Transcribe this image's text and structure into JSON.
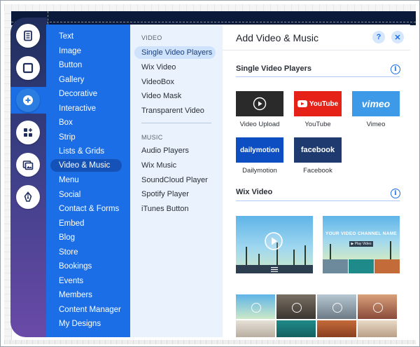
{
  "rail": {
    "buttons": [
      {
        "icon": "pages-icon"
      },
      {
        "icon": "background-icon"
      },
      {
        "icon": "add-icon"
      },
      {
        "icon": "add-apps-icon"
      },
      {
        "icon": "media-icon"
      },
      {
        "icon": "blog-pen-icon"
      }
    ],
    "active_icon": "add-icon"
  },
  "categories": {
    "items": [
      "Text",
      "Image",
      "Button",
      "Gallery",
      "Decorative",
      "Interactive",
      "Box",
      "Strip",
      "Lists & Grids",
      "Video & Music",
      "Menu",
      "Social",
      "Contact & Forms",
      "Embed",
      "Blog",
      "Store",
      "Bookings",
      "Events",
      "Members",
      "Content Manager",
      "My Designs"
    ],
    "selected": "Video & Music"
  },
  "sub": {
    "video_header": "VIDEO",
    "video_items": [
      "Single Video Players",
      "Wix Video",
      "VideoBox",
      "Video Mask",
      "Transparent Video"
    ],
    "music_header": "MUSIC",
    "music_items": [
      "Audio Players",
      "Wix Music",
      "SoundCloud Player",
      "Spotify Player",
      "iTunes Button"
    ],
    "selected": "Single Video Players"
  },
  "panel": {
    "title": "Add Video & Music",
    "help_label": "?",
    "close_label": "✕",
    "section1_title": "Single Video Players",
    "section2_title": "Wix Video",
    "info_label": "i",
    "players": [
      {
        "brand": "",
        "label": "Video Upload",
        "color": "#2a2a2a"
      },
      {
        "brand": "YouTube",
        "label": "YouTube",
        "color": "#e62117"
      },
      {
        "brand": "vimeo",
        "label": "Vimeo",
        "color": "#3d9ae8"
      },
      {
        "brand": "dailymotion",
        "label": "Dailymotion",
        "color": "#0d4ec2"
      },
      {
        "brand": "facebook",
        "label": "Facebook",
        "color": "#1f3a6e"
      }
    ],
    "channel_name": "YOUR VIDEO CHANNEL NAME",
    "play_video_label": "▶ Play Video"
  }
}
